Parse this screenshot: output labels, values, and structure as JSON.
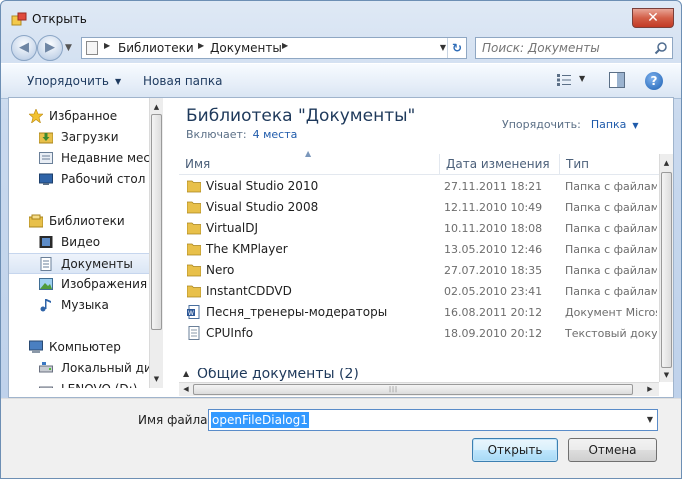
{
  "window": {
    "title": "Открыть",
    "close_glyph": "✕"
  },
  "nav": {
    "back_glyph": "◀",
    "forward_glyph": "▶",
    "breadcrumb": [
      "Библиотеки",
      "Документы"
    ],
    "search_placeholder": "Поиск: Документы"
  },
  "toolbar": {
    "organize_label": "Упорядочить",
    "new_folder_label": "Новая папка",
    "help_glyph": "?"
  },
  "sidebar": {
    "items": [
      {
        "label": "Избранное",
        "icon": "star-icon"
      },
      {
        "label": "Загрузки",
        "icon": "downloads-folder-icon"
      },
      {
        "label": "Недавние места",
        "icon": "recent-places-icon"
      },
      {
        "label": "Рабочий стол",
        "icon": "desktop-icon"
      },
      {
        "label": "Библиотеки",
        "icon": "libraries-icon"
      },
      {
        "label": "Видео",
        "icon": "video-icon"
      },
      {
        "label": "Документы",
        "icon": "documents-icon",
        "selected": true
      },
      {
        "label": "Изображения",
        "icon": "pictures-icon"
      },
      {
        "label": "Музыка",
        "icon": "music-icon"
      },
      {
        "label": "Компьютер",
        "icon": "computer-icon"
      },
      {
        "label": "Локальный диск",
        "icon": "local-disk-icon"
      },
      {
        "label": "LENOVO (D:)",
        "icon": "drive-icon"
      }
    ]
  },
  "library": {
    "title": "Библиотека \"Документы\"",
    "includes_label": "Включает:",
    "includes_link": "4 места",
    "arrange_label": "Упорядочить:",
    "arrange_value": "Папка"
  },
  "columns": {
    "name": "Имя",
    "date": "Дата изменения",
    "type": "Тип"
  },
  "files": [
    {
      "name": "Visual Studio 2010",
      "date": "27.11.2011 18:21",
      "type": "Папка с файлами",
      "icon": "folder-icon"
    },
    {
      "name": "Visual Studio 2008",
      "date": "12.11.2010 10:49",
      "type": "Папка с файлами",
      "icon": "folder-icon"
    },
    {
      "name": "VirtualDJ",
      "date": "10.11.2010 18:08",
      "type": "Папка с файлами",
      "icon": "folder-icon"
    },
    {
      "name": "The KMPlayer",
      "date": "13.05.2010 12:46",
      "type": "Папка с файлами",
      "icon": "folder-icon"
    },
    {
      "name": "Nero",
      "date": "27.07.2010 18:35",
      "type": "Папка с файлами",
      "icon": "folder-icon"
    },
    {
      "name": "InstantCDDVD",
      "date": "02.05.2010 23:41",
      "type": "Папка с файлами",
      "icon": "folder-icon"
    },
    {
      "name": "Песня_тренеры-модераторы",
      "date": "16.08.2011 20:12",
      "type": "Документ Micros",
      "icon": "word-document-icon"
    },
    {
      "name": "CPUInfo",
      "date": "18.09.2010 20:12",
      "type": "Текстовый доку",
      "icon": "text-document-icon"
    }
  ],
  "group": {
    "label": "Общие документы (2)"
  },
  "footer": {
    "filename_label": "Имя файла:",
    "filename_value": "openFileDialog1",
    "open_label": "Открыть",
    "cancel_label": "Отмена"
  },
  "colors": {
    "folder": "#e8c04a",
    "link": "#1f5bab",
    "selection": "#3399ff"
  }
}
